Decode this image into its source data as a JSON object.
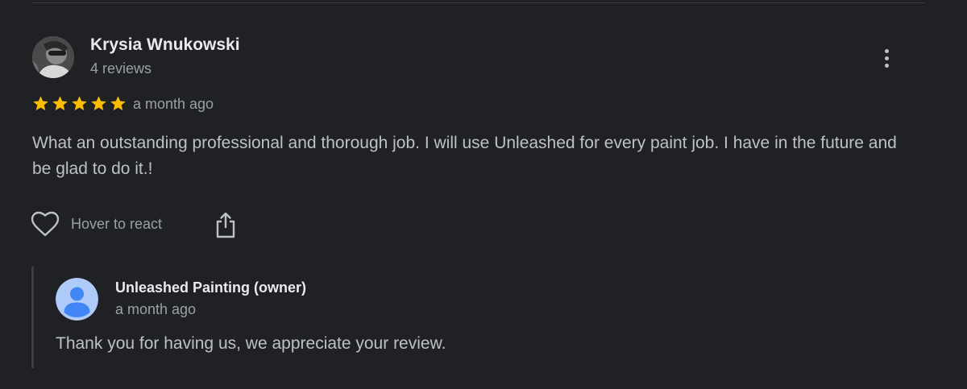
{
  "review": {
    "reviewer_name": "Krysia Wnukowski",
    "reviewer_count": "4 reviews",
    "rating": 5,
    "rating_max": 5,
    "time": "a month ago",
    "text": "What an outstanding professional and thorough job. I will use Unleashed for every paint job. I have in the future and be glad to do it.!",
    "react_label": "Hover to react"
  },
  "owner_reply": {
    "name": "Unleashed Painting (owner)",
    "time": "a month ago",
    "text": "Thank you for having us, we appreciate your review."
  },
  "colors": {
    "background": "#202124",
    "star": "#fbbc04",
    "owner_avatar_bg": "#aecbfa",
    "owner_avatar_fg": "#4285f4"
  },
  "icons": {
    "more": "more-vert-icon",
    "react": "heart-outline-icon",
    "share": "share-icon",
    "owner_avatar": "person-icon"
  }
}
